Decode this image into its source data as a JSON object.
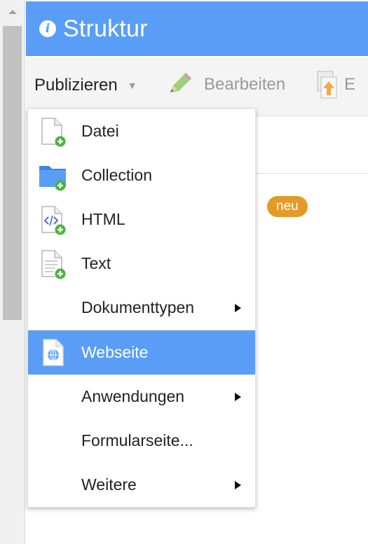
{
  "header": {
    "title": "Struktur"
  },
  "toolbar": {
    "publish_label": "Publizieren",
    "edit_label": "Bearbeiten",
    "more_label_truncated": "E"
  },
  "content": {
    "badge": "neu"
  },
  "menu": {
    "items": [
      {
        "label": "Datei",
        "icon": "file-add-icon"
      },
      {
        "label": "Collection",
        "icon": "folder-add-icon"
      },
      {
        "label": "HTML",
        "icon": "html-file-add-icon"
      },
      {
        "label": "Text",
        "icon": "text-file-add-icon"
      },
      {
        "label": "Dokumenttypen",
        "submenu": true
      },
      {
        "label": "Webseite",
        "icon": "webpage-icon",
        "selected": true
      },
      {
        "label": "Anwendungen",
        "submenu": true
      },
      {
        "label": "Formularseite...",
        "submenu": false
      },
      {
        "label": "Weitere",
        "submenu": true
      }
    ]
  },
  "colors": {
    "accent": "#5a9df7",
    "badge": "#e49a27",
    "add_green": "#48b43d"
  }
}
